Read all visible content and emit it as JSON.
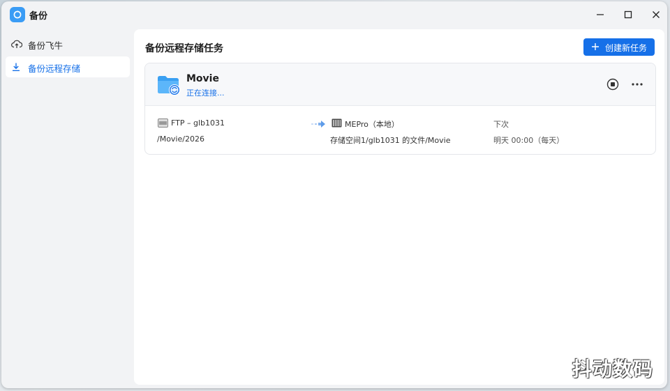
{
  "app": {
    "title": "备份",
    "icon": "backup-app-icon"
  },
  "window_controls": {
    "minimize": "minimize-icon",
    "maximize": "maximize-icon",
    "close": "close-icon"
  },
  "sidebar": {
    "items": [
      {
        "label": "备份飞牛",
        "icon": "cloud-upload-icon",
        "active": false
      },
      {
        "label": "备份远程存储",
        "icon": "download-icon",
        "active": true
      }
    ]
  },
  "main": {
    "title": "备份远程存储任务",
    "create_button": "创建新任务"
  },
  "task": {
    "name": "Movie",
    "status": "正在连接...",
    "source": {
      "name": "FTP – glb1031",
      "path": "/Movie/2026",
      "icon": "ftp-icon"
    },
    "destination": {
      "name": "MEPro（本地）",
      "path": "存储空间1/glb1031 的文件/Movie",
      "icon": "nas-device-icon"
    },
    "schedule": {
      "label": "下次",
      "value": "明天 00:00（每天）"
    }
  },
  "watermark": "抖动数码",
  "colors": {
    "accent": "#1670e8",
    "window_bg": "#f2f3f5",
    "panel_bg": "#ffffff"
  }
}
